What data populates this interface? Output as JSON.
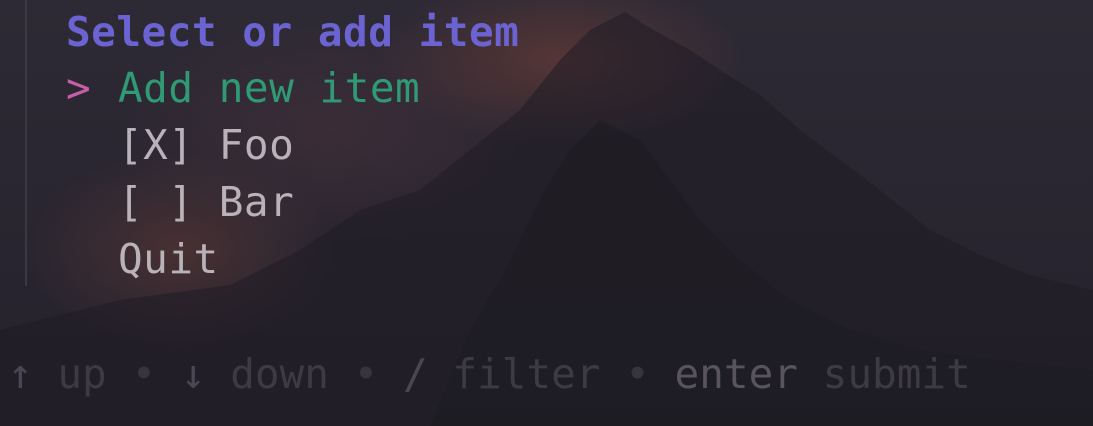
{
  "prompt": {
    "title": "Select or add item",
    "cursor": ">",
    "options": [
      {
        "label": "Add new item",
        "selected": true
      },
      {
        "label": "[X] Foo",
        "selected": false
      },
      {
        "label": "[ ] Bar",
        "selected": false
      },
      {
        "label": "Quit",
        "selected": false
      }
    ]
  },
  "help": {
    "items": [
      {
        "key": "↑",
        "desc": "up"
      },
      {
        "key": "↓",
        "desc": "down"
      },
      {
        "key": "/",
        "desc": "filter"
      },
      {
        "key": "enter",
        "desc": "submit"
      }
    ],
    "separator": "•"
  },
  "colors": {
    "title": "#6b63d2",
    "cursor": "#c85da8",
    "selected": "#2f9a74",
    "option": "#b9b2b8",
    "help": "#4a4653"
  }
}
